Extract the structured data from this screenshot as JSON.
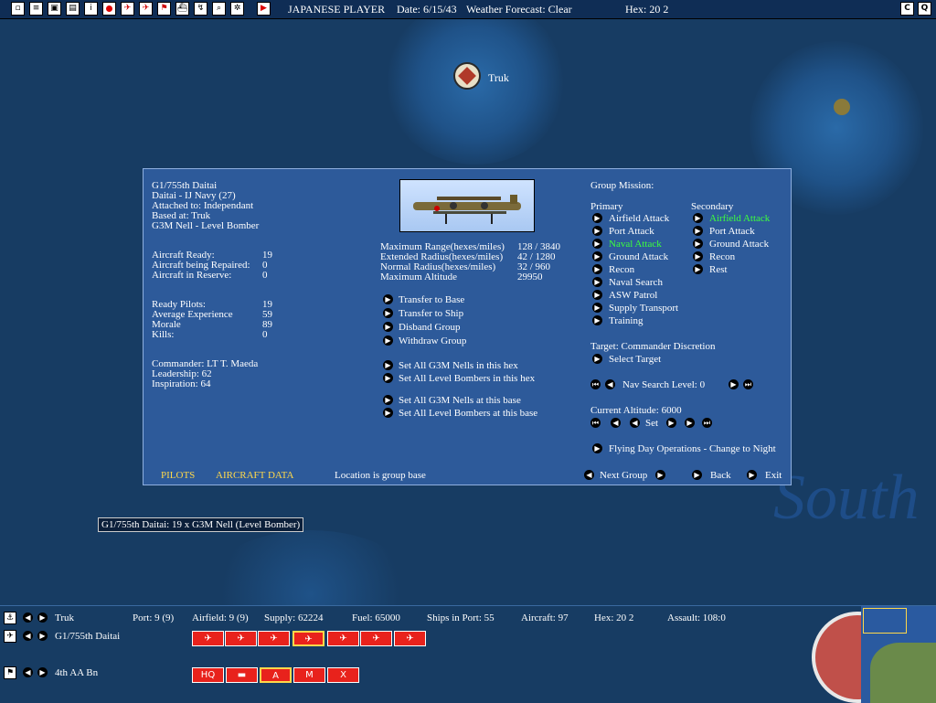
{
  "topbar": {
    "player": "JAPANESE PLAYER",
    "date": "Date:  6/15/43",
    "weather": "Weather Forecast: Clear",
    "hex": "Hex: 20 2",
    "buttons": [
      "window-icon",
      "list-icon",
      "briefcase-icon",
      "save-icon",
      "info-icon",
      "flag-icon",
      "plane-red-icon",
      "plane-alt-icon",
      "flag-marker-icon",
      "ship-icon",
      "route-icon",
      "zoom-icon",
      "settings-icon",
      "end-turn-icon"
    ],
    "right_buttons": [
      "C",
      "Q"
    ]
  },
  "map": {
    "base_label": "Truk",
    "region_label": "South"
  },
  "panel": {
    "group_name": "G1/755th Daitai",
    "daitai": "Daitai - IJ Navy (27)",
    "attached": "Attached to:  Independant",
    "based": "Based at: Truk",
    "aircraft_type": "G3M Nell - Level Bomber",
    "stats1": [
      {
        "label": "Aircraft Ready:",
        "value": "19"
      },
      {
        "label": "Aircraft being Repaired:",
        "value": "0"
      },
      {
        "label": "Aircraft in Reserve:",
        "value": "0"
      }
    ],
    "stats2": [
      {
        "label": "Ready Pilots:",
        "value": "19"
      },
      {
        "label": "Average Experience",
        "value": "59"
      },
      {
        "label": "Morale",
        "value": "89"
      },
      {
        "label": "Kills:",
        "value": "0"
      }
    ],
    "commander": "Commander:  LT T. Maeda",
    "leadership": "Leadership:   62",
    "inspiration": "Inspiration:   64",
    "ranges": [
      {
        "label": "Maximum Range(hexes/miles)",
        "value": "128 / 3840"
      },
      {
        "label": "Extended Radius(hexes/miles)",
        "value": "42 / 1280"
      },
      {
        "label": "Normal Radius(hexes/miles)",
        "value": "32 / 960"
      },
      {
        "label": "Maximum Altitude",
        "value": "29950"
      }
    ],
    "actions1": [
      "Transfer to Base",
      "Transfer to Ship",
      "Disband Group",
      "Withdraw Group"
    ],
    "actions2": [
      "Set All G3M Nells in this hex",
      "Set All Level Bombers in this hex"
    ],
    "actions3": [
      "Set All G3M Nells at this base",
      "Set All Level Bombers at this base"
    ],
    "mission_title": "Group Mission:",
    "primary_title": "Primary",
    "secondary_title": "Secondary",
    "primary": [
      "Airfield Attack",
      "Port Attack",
      "Naval Attack",
      "Ground Attack",
      "Recon",
      "Naval Search",
      "ASW Patrol",
      "Supply Transport",
      "Training"
    ],
    "secondary": [
      "Airfield Attack",
      "Port Attack",
      "Ground Attack",
      "Recon",
      "Rest"
    ],
    "target": "Target:  Commander Discretion",
    "select_target": "Select Target",
    "nav_search": "Nav Search Level: 0",
    "current_altitude": "Current Altitude:  6000",
    "set": "Set",
    "flying": "Flying Day Operations - Change to Night",
    "tab_pilots": "PILOTS",
    "tab_aircraft": "AIRCRAFT DATA",
    "location_note": "Location is group base",
    "next_group": "Next Group",
    "back": "Back",
    "exit": "Exit",
    "highlight_color": "#3dff3d",
    "tab_color": "#ffd84a"
  },
  "tooltip": "G1/755th Daitai:  19 x G3M Nell (Level Bomber)",
  "bottombar": {
    "base": "Truk",
    "port": "Port: 9 (9)",
    "airfield": "Airfield: 9 (9)",
    "supply": "Supply: 62224",
    "fuel": "Fuel: 65000",
    "ships": "Ships in Port: 55",
    "aircraft": "Aircraft: 97",
    "hex": "Hex: 20 2",
    "assault": "Assault: 108:0",
    "air_group": "G1/755th Daitai",
    "ground_unit": "4th AA Bn",
    "unit_icons_air": [
      "plane-icon",
      "plane-icon",
      "plane-icon",
      "plane-selected-icon",
      "plane-icon",
      "plane-icon",
      "plane-icon"
    ],
    "unit_icons_ground": [
      "HQ",
      "",
      "A",
      "M",
      "X"
    ]
  }
}
